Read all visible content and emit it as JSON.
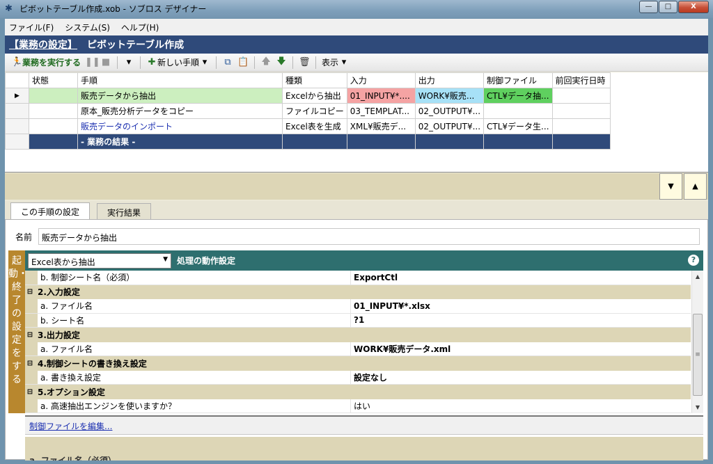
{
  "window": {
    "title": "ピボットテーブル作成.xob - ソブロス デザイナー",
    "minimize": "—",
    "maximize": "□",
    "close": "X"
  },
  "menu": [
    "ファイル(F)",
    "システム(S)",
    "ヘルプ(H)"
  ],
  "header": {
    "mode": "【業務の設定】",
    "title": "ピボットテーブル作成"
  },
  "toolbar": {
    "run_label": "業務を実行する",
    "new_step_label": "新しい手順",
    "view_label": "表示"
  },
  "grid": {
    "columns": [
      "状態",
      "手順",
      "種類",
      "入力",
      "出力",
      "制御ファイル",
      "前回実行日時"
    ],
    "rows": [
      {
        "state": "",
        "step": "販売データから抽出",
        "kind": "Excelから抽出",
        "input": "01_INPUT¥*....",
        "output": "WORK¥販売...",
        "control": "CTL¥データ抽...",
        "last": ""
      },
      {
        "state": "",
        "step": "原本_販売分析データをコピー",
        "kind": "ファイルコピー",
        "input": "03_TEMPLAT...",
        "output": "02_OUTPUT¥...",
        "control": "",
        "last": ""
      },
      {
        "state": "",
        "step": "販売データのインポート",
        "kind": "Excel表を生成",
        "input": "XML¥販売デ...",
        "output": "02_OUTPUT¥...",
        "control": "CTL¥データ生...",
        "last": ""
      }
    ],
    "result_row": "- 業務の結果 -"
  },
  "tabs": [
    "この手順の設定",
    "実行結果"
  ],
  "name": {
    "label": "名前",
    "value": "販売データから抽出"
  },
  "side_strip": "起動・終了の設定をする",
  "settings": {
    "combo": "Excel表から抽出",
    "title": "処理の動作設定",
    "help": "?"
  },
  "properties": [
    {
      "type": "item",
      "name": "b. 制御シート名（必須）",
      "value": "ExportCtl",
      "bold": true
    },
    {
      "type": "group",
      "name": "2.入力設定"
    },
    {
      "type": "item",
      "name": "a. ファイル名",
      "value": "01_INPUT¥*.xlsx",
      "bold": true
    },
    {
      "type": "item",
      "name": "b. シート名",
      "value": "?1",
      "bold": true
    },
    {
      "type": "group",
      "name": "3.出力設定"
    },
    {
      "type": "item",
      "name": "a. ファイル名",
      "value": "WORK¥販売データ.xml",
      "bold": true
    },
    {
      "type": "group",
      "name": "4.制御シートの書き換え設定"
    },
    {
      "type": "item",
      "name": "a. 書き換え設定",
      "value": "設定なし",
      "bold": true
    },
    {
      "type": "group",
      "name": "5.オプション設定"
    },
    {
      "type": "item",
      "name": "a. 高速抽出エンジンを使いますか？",
      "value": "はい",
      "bold": false
    }
  ],
  "edit_link": "制御ファイルを編集...",
  "bottom_hint": "a. ファイル名（必須）"
}
